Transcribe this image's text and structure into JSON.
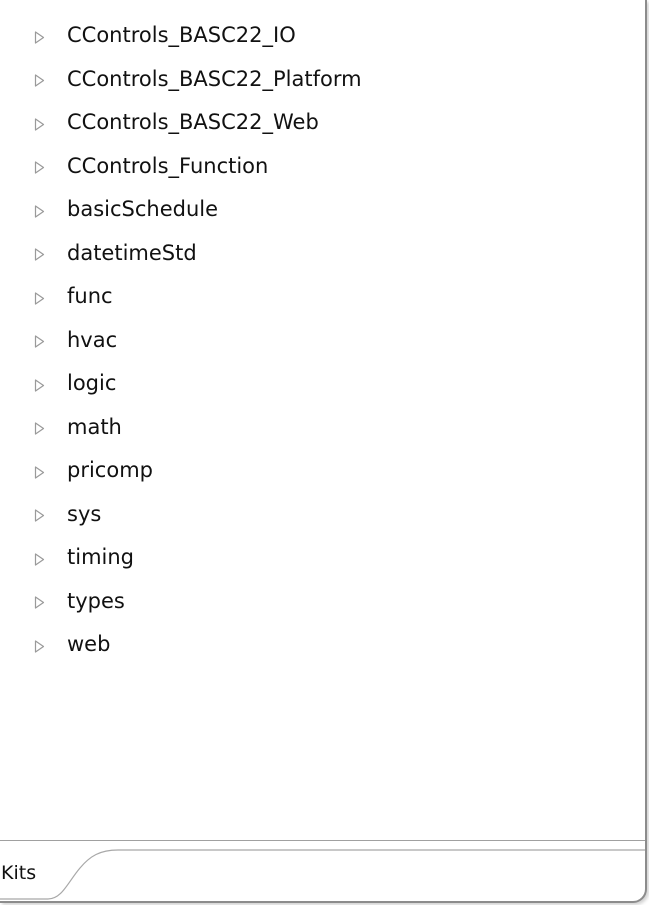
{
  "tree": {
    "items": [
      {
        "label": "CControls_BASC22_IO",
        "expander_icon": "triangle-right-outline"
      },
      {
        "label": "CControls_BASC22_Platform",
        "expander_icon": "triangle-right-outline"
      },
      {
        "label": "CControls_BASC22_Web",
        "expander_icon": "triangle-right-outline"
      },
      {
        "label": "CControls_Function",
        "expander_icon": "triangle-right-outline"
      },
      {
        "label": "basicSchedule",
        "expander_icon": "triangle-right-outline"
      },
      {
        "label": "datetimeStd",
        "expander_icon": "triangle-right-outline"
      },
      {
        "label": "func",
        "expander_icon": "triangle-right-outline"
      },
      {
        "label": "hvac",
        "expander_icon": "triangle-right-outline"
      },
      {
        "label": "logic",
        "expander_icon": "triangle-right-outline"
      },
      {
        "label": "math",
        "expander_icon": "triangle-right-outline"
      },
      {
        "label": "pricomp",
        "expander_icon": "triangle-right-outline"
      },
      {
        "label": "sys",
        "expander_icon": "triangle-right-outline"
      },
      {
        "label": "timing",
        "expander_icon": "triangle-right-outline"
      },
      {
        "label": "types",
        "expander_icon": "triangle-right-outline"
      },
      {
        "label": "web",
        "expander_icon": "triangle-right-outline"
      }
    ]
  },
  "tabs": [
    {
      "label": "Kits",
      "active": true
    }
  ],
  "colors": {
    "text": "#111111",
    "expander": "#9a9a9a",
    "border": "#8c8c8c",
    "divider": "#a0a0a0",
    "background": "#ffffff"
  }
}
